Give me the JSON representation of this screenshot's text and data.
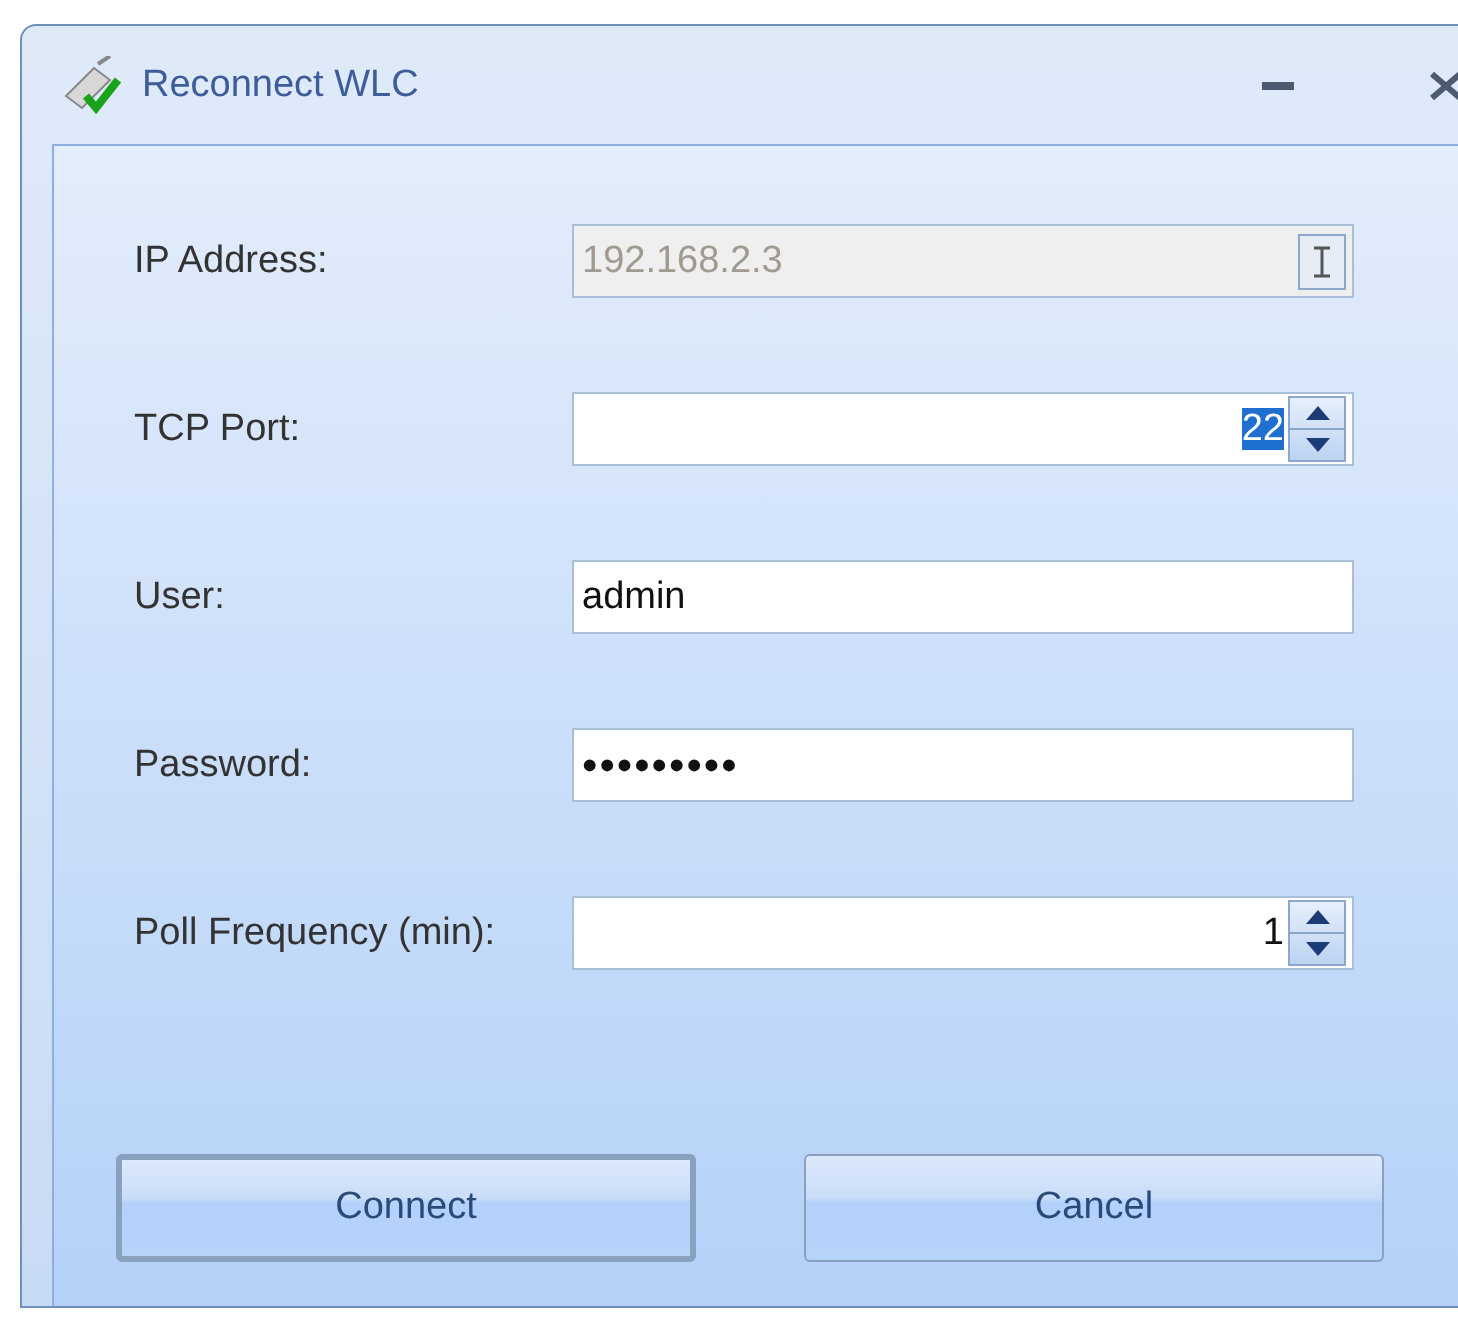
{
  "window": {
    "title": "Reconnect WLC"
  },
  "fields": [
    {
      "label": "IP Address:",
      "kind": "text",
      "value": "192.168.2.3",
      "disabled": true
    },
    {
      "label": "TCP Port:",
      "kind": "spin",
      "value": "22",
      "selected": true,
      "disabled": false
    },
    {
      "label": "User:",
      "kind": "text",
      "value": "admin",
      "disabled": false
    },
    {
      "label": "Password:",
      "kind": "password",
      "value": "•••••••••",
      "disabled": false
    },
    {
      "label": "Poll Frequency (min):",
      "kind": "spin",
      "value": "1",
      "selected": false,
      "disabled": false
    }
  ],
  "buttons": [
    {
      "label": "Connect",
      "default": true
    },
    {
      "label": "Cancel",
      "default": false
    }
  ]
}
